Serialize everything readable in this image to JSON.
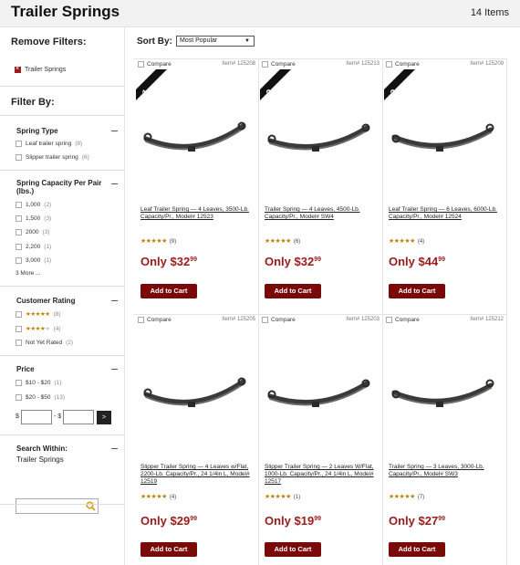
{
  "header": {
    "title": "Trailer Springs",
    "count": "14 Items"
  },
  "sidebar": {
    "remove_filters": "Remove Filters:",
    "active_filter": "Trailer Springs",
    "filter_by": "Filter By:",
    "spring_type": {
      "title": "Spring Type",
      "options": [
        {
          "label": "Leaf trailer spring",
          "count": "(8)"
        },
        {
          "label": "Slipper trailer spring",
          "count": "(6)"
        }
      ]
    },
    "capacity": {
      "title": "Spring Capacity Per Pair (lbs.)",
      "options": [
        {
          "label": "1,000",
          "count": "(2)"
        },
        {
          "label": "1,500",
          "count": "(3)"
        },
        {
          "label": "2000",
          "count": "(3)"
        },
        {
          "label": "2,200",
          "count": "(1)"
        },
        {
          "label": "3,000",
          "count": "(1)"
        }
      ],
      "more": "3 More ..."
    },
    "rating": {
      "title": "Customer Rating",
      "options": [
        {
          "stars": 5,
          "count": "(8)"
        },
        {
          "stars": 4,
          "count": "(4)"
        }
      ],
      "not_rated": {
        "label": "Not Yet Rated",
        "count": "(2)"
      }
    },
    "price": {
      "title": "Price",
      "options": [
        {
          "label": "$10 - $20",
          "count": "(1)"
        },
        {
          "label": "$20 - $50",
          "count": "(13)"
        }
      ],
      "dollar": "$",
      "dash": "- $",
      "go": ">"
    },
    "search_within": {
      "title": "Search Within:",
      "subtitle": "Trailer Springs",
      "placeholder": ""
    }
  },
  "sort": {
    "label": "Sort By:",
    "value": "Most Popular"
  },
  "products": [
    {
      "compare": "Compare",
      "item": "Item# 125208",
      "ribbon": "1",
      "ribbon_text": "SELLER",
      "name": "Leaf Trailer Spring — 4 Leaves, 3500-Lb. Capacity/Pr., Model# 12523",
      "rating": 5,
      "reviews": "(9)",
      "only": "Only ",
      "price_dollars": "$32",
      "price_cents": "99",
      "cta": "Add to Cart"
    },
    {
      "compare": "Compare",
      "item": "Item# 125213",
      "ribbon": "2",
      "ribbon_text": "SELLER",
      "name": "Trailer Spring — 4 Leaves, 4500-Lb. Capacity/Pr., Model# SW4",
      "rating": 5,
      "reviews": "(6)",
      "only": "Only ",
      "price_dollars": "$32",
      "price_cents": "99",
      "cta": "Add to Cart"
    },
    {
      "compare": "Compare",
      "item": "Item# 125209",
      "ribbon": "3",
      "ribbon_text": "SELLER",
      "name": "Leaf Trailer Spring — 6 Leaves, 6000-Lb. Capacity/Pr., Model# 12524",
      "rating": 5,
      "reviews": "(4)",
      "only": "Only ",
      "price_dollars": "$44",
      "price_cents": "99",
      "cta": "Add to Cart"
    },
    {
      "compare": "Compare",
      "item": "Item# 125205",
      "name": "Slipper Trailer Spring — 4 Leaves w/Flat, 2200-Lb. Capacity/Pr., 24 1/4in L, Model# 12519",
      "rating": 5,
      "reviews": "(4)",
      "only": "Only ",
      "price_dollars": "$29",
      "price_cents": "99",
      "cta": "Add to Cart"
    },
    {
      "compare": "Compare",
      "item": "Item# 125203",
      "name": "Slipper Trailer Spring — 2 Leaves W/Flat, 1000-Lb. Capacity/Pr., 24 1/4in L, Model# 12517",
      "rating": 5,
      "reviews": "(1)",
      "only": "Only ",
      "price_dollars": "$19",
      "price_cents": "99",
      "cta": "Add to Cart"
    },
    {
      "compare": "Compare",
      "item": "Item# 125212",
      "name": "Trailer Spring — 3 Leaves, 3000-Lb. Capacity/Pr., Model# SW3",
      "rating": 5,
      "reviews": "(7)",
      "only": "Only ",
      "price_dollars": "$27",
      "price_cents": "99",
      "cta": "Add to Cart"
    }
  ]
}
